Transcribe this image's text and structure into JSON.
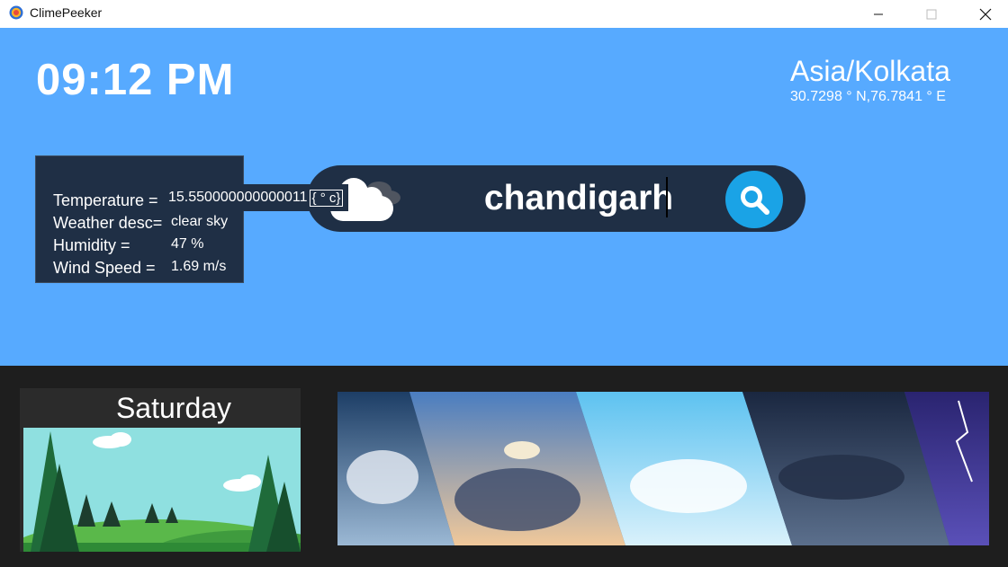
{
  "window": {
    "title": "ClimePeeker",
    "minimize_glyph": "—",
    "maximize_glyph": "☐",
    "close_glyph": "✕"
  },
  "clock": {
    "time": "09:12 PM"
  },
  "location": {
    "timezone": "Asia/Kolkata",
    "coordinates": "30.7298 ° N,76.7841 ° E"
  },
  "search": {
    "value": "chandigarh",
    "icon": "search-icon",
    "weather_icon": "cloud-icon"
  },
  "weather": {
    "temperature_label": "Temperature =",
    "temperature_value": "15.550000000000011",
    "temperature_unit": "{ ° c}",
    "description_label": "Weather desc=",
    "description_value": "clear sky",
    "humidity_label": "Humidity =",
    "humidity_value": "47 %",
    "wind_label": "Wind Speed =",
    "wind_value": "1.69 m/s"
  },
  "forecast": {
    "day": "Saturday"
  },
  "colors": {
    "top_bg": "#57aaff",
    "panel_bg": "#1f2f45",
    "bottom_bg": "#1e1e1e",
    "search_button": "#1aa3e6"
  }
}
